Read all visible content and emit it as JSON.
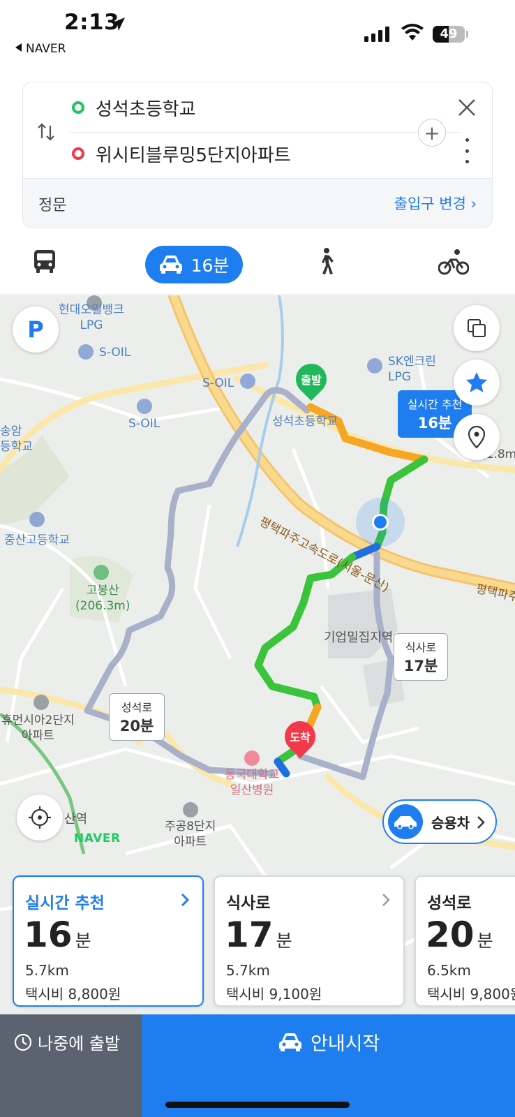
{
  "status_bar": {
    "time": "2:13",
    "back_app": "NAVER",
    "battery": "49"
  },
  "search": {
    "origin": "성석초등학교",
    "destination": "위시티블루밍5단지아파트",
    "entrance_label": "정문",
    "entrance_change": "출입구 변경 ›"
  },
  "modes": {
    "car_time": "16분"
  },
  "map": {
    "labels": {
      "lpg1": "현대오일뱅크\nLPG",
      "soil1": "S-OIL",
      "soil2": "S-OIL",
      "soil3": "S-OIL",
      "sk": "SK엔크린\nLPG",
      "school_origin": "성석초등학교",
      "school_left": "중산고등학교",
      "school_left_top": "송암\n등학교",
      "mountain": "고봉산\n(206.3m)",
      "highway": "평택파주고속도로(서울-문산)",
      "highway_right": "평택파주",
      "industrial": "기업밀집지역",
      "apt_left": "휴먼시아2단지\n아파트",
      "hospital": "동국대학교\n일산병원",
      "apt_bottom": "주공8단지\n아파트",
      "station": "산역",
      "height_right": "(1.8m)"
    },
    "pins": {
      "start": "출발",
      "end": "도착"
    },
    "callouts": {
      "recommended": {
        "name": "실시간 추천",
        "time": "16분"
      },
      "siksa": {
        "name": "식사로",
        "time": "17분"
      },
      "seongseok": {
        "name": "성석로",
        "time": "20분"
      }
    },
    "vehicle": "승용차",
    "logo": "NAVER"
  },
  "routes": [
    {
      "name": "실시간 추천",
      "time": "16",
      "unit": "분",
      "distance": "5.7km",
      "fare": "택시비 8,800원"
    },
    {
      "name": "식사로",
      "time": "17",
      "unit": "분",
      "distance": "5.7km",
      "fare": "택시비 9,100원"
    },
    {
      "name": "성석로",
      "time": "20",
      "unit": "분",
      "distance": "6.5km",
      "fare": "택시비 9,800원"
    }
  ],
  "bottom": {
    "later": "나중에 출발",
    "start": "안내시작"
  },
  "colors": {
    "accent": "#1e7ef0",
    "traffic_green": "#3bc43b",
    "traffic_orange": "#f5a623",
    "alt_route": "#a9b0c9"
  }
}
